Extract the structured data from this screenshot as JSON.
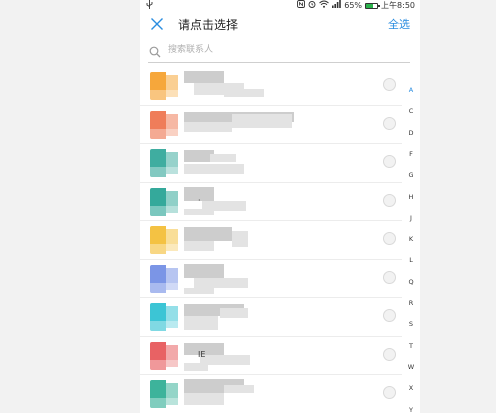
{
  "status_bar": {
    "usb_icon": "usb-icon",
    "battery_percent": "65%",
    "battery_level": 0.65,
    "time": "上午8:50"
  },
  "header": {
    "title": "请点击选择",
    "select_all": "全选"
  },
  "search": {
    "placeholder": "搜索联系人"
  },
  "contacts": [
    {
      "avatar_color": "#f6a73b",
      "name_fragment": ""
    },
    {
      "avatar_color": "#ef7d5a",
      "name_fragment": ""
    },
    {
      "avatar_color": "#3fada0",
      "name_fragment": ""
    },
    {
      "avatar_color": "#34a99b",
      "name_fragment": "·"
    },
    {
      "avatar_color": "#f4c243",
      "name_fragment": ""
    },
    {
      "avatar_color": "#7b95e6",
      "name_fragment": ""
    },
    {
      "avatar_color": "#3cc5d5",
      "name_fragment": ""
    },
    {
      "avatar_color": "#e86264",
      "name_fragment": "IE"
    },
    {
      "avatar_color": "#3db39b",
      "name_fragment": ""
    }
  ],
  "alpha_index": [
    "A",
    "C",
    "D",
    "F",
    "G",
    "H",
    "J",
    "K",
    "L",
    "Q",
    "R",
    "S",
    "T",
    "W",
    "X",
    "Y"
  ],
  "colors": {
    "accent": "#2a8de0",
    "battery": "#2bb24c"
  }
}
